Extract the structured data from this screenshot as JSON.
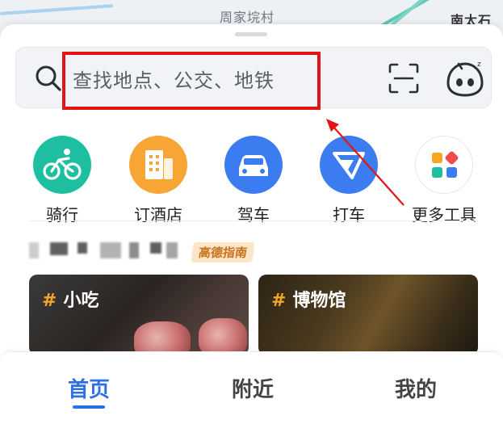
{
  "map": {
    "labels": [
      "周家垸村",
      "南太石"
    ]
  },
  "search": {
    "placeholder": "查找地点、公交、地铁"
  },
  "tools": [
    {
      "label": "骑行",
      "icon": "bicycle-icon",
      "color": "#1dbfa0"
    },
    {
      "label": "订酒店",
      "icon": "hotel-building-icon",
      "color": "#f7a534"
    },
    {
      "label": "驾车",
      "icon": "car-icon",
      "color": "#3b7cf0"
    },
    {
      "label": "打车",
      "icon": "taxi-arrow-icon",
      "color": "#3b7cf0"
    },
    {
      "label": "更多工具",
      "icon": "more-tools-grid-icon",
      "color": "#ffffff"
    }
  ],
  "guide": {
    "badge": "高德指南"
  },
  "cards": [
    {
      "title": "小吃",
      "hash": "#"
    },
    {
      "title": "博物馆",
      "hash": "#"
    }
  ],
  "tabbar": {
    "tabs": [
      "首页",
      "附近",
      "我的"
    ],
    "active": "首页",
    "active_color": "#2f6fe4"
  },
  "annotation": {
    "highlight_color": "#e11515"
  }
}
